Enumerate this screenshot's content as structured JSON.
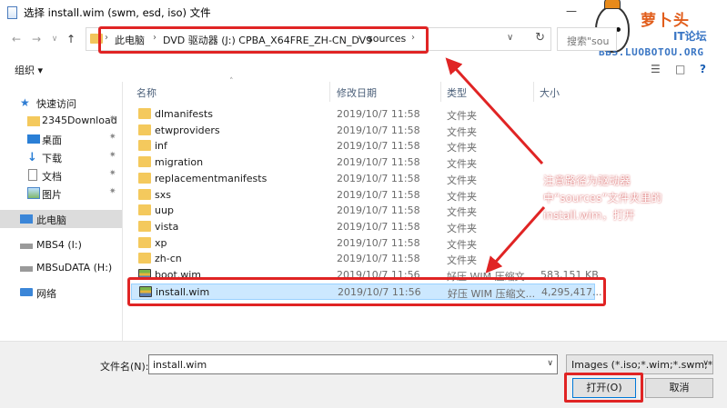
{
  "window": {
    "title": "选择 install.wim (swm, esd, iso) 文件",
    "minimize_glyph": "—"
  },
  "logo": {
    "text_cn": "萝卜头",
    "text_it": "IT论坛",
    "text_bbs": "BBS.LUOBOTOU.ORG"
  },
  "nav": {
    "back": "←",
    "forward": "→",
    "dropdown": "∨",
    "up": "↑"
  },
  "address": {
    "crumbs": [
      "此电脑",
      "DVD 驱动器 (J:) CPBA_X64FRE_ZH-CN_DV9",
      "sources"
    ],
    "sep": "›",
    "dropdown": "∨",
    "refresh": "↻"
  },
  "search": {
    "placeholder": "搜索\"sou"
  },
  "toolbar": {
    "organize": "组织 ▾",
    "view": "☰",
    "pane": "□",
    "help": "?"
  },
  "sidebar": {
    "items": [
      {
        "label": "快速访问",
        "icon": "star-icon",
        "pinned": false
      },
      {
        "label": "2345Download",
        "icon": "folder-icon",
        "pinned": true
      },
      {
        "label": "桌面",
        "icon": "desktop-icon",
        "pinned": true
      },
      {
        "label": "下载",
        "icon": "download-icon",
        "pinned": true
      },
      {
        "label": "文档",
        "icon": "document-icon",
        "pinned": true
      },
      {
        "label": "图片",
        "icon": "picture-icon",
        "pinned": true
      },
      {
        "label": "此电脑",
        "icon": "computer-icon",
        "pinned": false,
        "selected": true
      },
      {
        "label": "MBS4 (I:)",
        "icon": "drive-icon",
        "pinned": false
      },
      {
        "label": "MBSuDATA (H:)",
        "icon": "drive-icon",
        "pinned": false
      },
      {
        "label": "网络",
        "icon": "network-icon",
        "pinned": false
      }
    ],
    "pin_glyph": "✷"
  },
  "list": {
    "headers": {
      "name": "名称",
      "date": "修改日期",
      "type": "类型",
      "size": "大小"
    },
    "sort_glyph": "˄",
    "rows": [
      {
        "name": "dlmanifests",
        "date": "2019/10/7 11:58",
        "type": "文件夹",
        "size": "",
        "kind": "folder"
      },
      {
        "name": "etwproviders",
        "date": "2019/10/7 11:58",
        "type": "文件夹",
        "size": "",
        "kind": "folder"
      },
      {
        "name": "inf",
        "date": "2019/10/7 11:58",
        "type": "文件夹",
        "size": "",
        "kind": "folder"
      },
      {
        "name": "migration",
        "date": "2019/10/7 11:58",
        "type": "文件夹",
        "size": "",
        "kind": "folder"
      },
      {
        "name": "replacementmanifests",
        "date": "2019/10/7 11:58",
        "type": "文件夹",
        "size": "",
        "kind": "folder"
      },
      {
        "name": "sxs",
        "date": "2019/10/7 11:58",
        "type": "文件夹",
        "size": "",
        "kind": "folder"
      },
      {
        "name": "uup",
        "date": "2019/10/7 11:58",
        "type": "文件夹",
        "size": "",
        "kind": "folder"
      },
      {
        "name": "vista",
        "date": "2019/10/7 11:58",
        "type": "文件夹",
        "size": "",
        "kind": "folder"
      },
      {
        "name": "xp",
        "date": "2019/10/7 11:58",
        "type": "文件夹",
        "size": "",
        "kind": "folder"
      },
      {
        "name": "zh-cn",
        "date": "2019/10/7 11:58",
        "type": "文件夹",
        "size": "",
        "kind": "folder"
      },
      {
        "name": "boot.wim",
        "date": "2019/10/7 11:56",
        "type": "好压 WIM 压缩文...",
        "size": "583,151 KB",
        "kind": "wim"
      },
      {
        "name": "install.wim",
        "date": "2019/10/7 11:56",
        "type": "好压 WIM 压缩文...",
        "size": "4,295,417...",
        "kind": "wim",
        "selected": true
      }
    ]
  },
  "annotation": {
    "lines": [
      "注意路径为驱动器",
      "中“sources”文件夹里的",
      "install.wim，打开"
    ],
    "color": "#e02424"
  },
  "bottom": {
    "filename_label": "文件名(N):",
    "filename_value": "install.wim",
    "filter": "Images (*.iso;*.wim;*.swm;*.e",
    "dropdown": "∨",
    "open": "打开(O)",
    "cancel": "取消"
  }
}
